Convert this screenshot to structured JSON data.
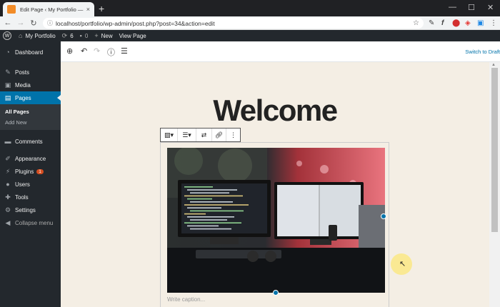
{
  "browser": {
    "tab_title": "Edit Page ‹ My Portfolio — Word",
    "tab_close": "×",
    "new_tab": "+",
    "minimize": "—",
    "maximize": "☐",
    "close": "✕",
    "url": "localhost/portfolio/wp-admin/post.php?post=34&action=edit"
  },
  "adminbar": {
    "site_name": "My Portfolio",
    "updates_count": "6",
    "comments_count": "0",
    "new_label": "New",
    "view_label": "View Page"
  },
  "sidebar": {
    "items": [
      {
        "label": "Dashboard",
        "icon": "dashboard-icon"
      },
      {
        "label": "Posts",
        "icon": "pushpin-icon"
      },
      {
        "label": "Media",
        "icon": "media-icon"
      },
      {
        "label": "Pages",
        "icon": "pages-icon",
        "active": true
      },
      {
        "label": "Comments",
        "icon": "comment-icon"
      },
      {
        "label": "Appearance",
        "icon": "paintbrush-icon"
      },
      {
        "label": "Plugins",
        "icon": "plugin-icon",
        "badge": "1"
      },
      {
        "label": "Users",
        "icon": "users-icon"
      },
      {
        "label": "Tools",
        "icon": "wrench-icon"
      },
      {
        "label": "Settings",
        "icon": "settings-icon"
      },
      {
        "label": "Collapse menu",
        "icon": "collapse-icon"
      }
    ],
    "submenu": [
      "All Pages",
      "Add New"
    ]
  },
  "editor": {
    "switch_to_draft": "Switch to Draft",
    "page_title": "Welcome",
    "caption_placeholder": "Write caption..."
  },
  "colors": {
    "admin_dark": "#23282d",
    "accent": "#0073aa",
    "canvas_bg": "#f4eee4"
  }
}
